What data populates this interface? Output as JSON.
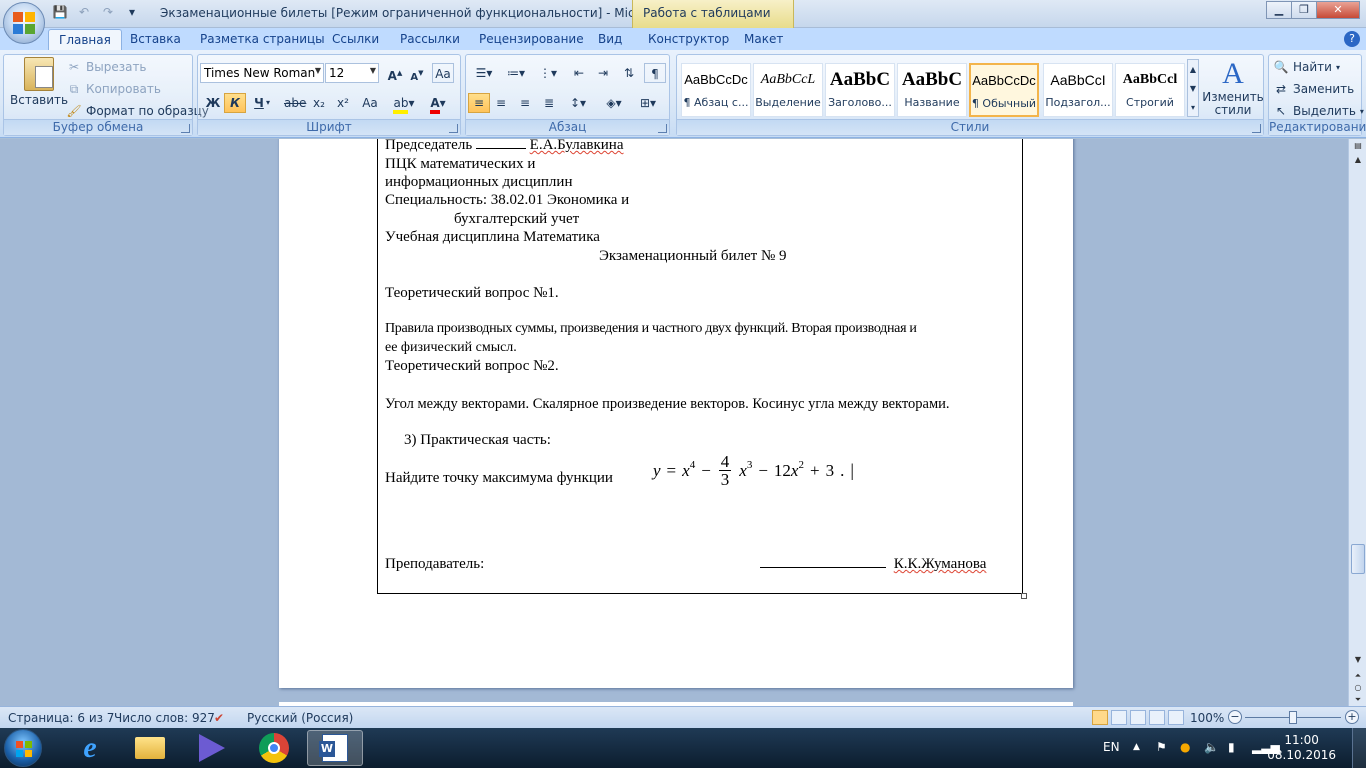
{
  "window": {
    "title": "Экзаменационные билеты  [Режим ограниченной функциональности] - Microso...",
    "context_tab_group": "Работа с таблицами",
    "controls": {
      "minimize": "▁",
      "maximize": "❐",
      "close": "✕"
    }
  },
  "tabs": [
    "Главная",
    "Вставка",
    "Разметка страницы",
    "Ссылки",
    "Рассылки",
    "Рецензирование",
    "Вид",
    "Конструктор",
    "Макет"
  ],
  "ribbon": {
    "clipboard": {
      "paste": "Вставить",
      "cut": "Вырезать",
      "copy": "Копировать",
      "format_painter": "Формат по образцу",
      "label": "Буфер обмена"
    },
    "font": {
      "font_name": "Times New Roman",
      "font_size": "12",
      "bold": "Ж",
      "italic": "К",
      "underline": "Ч",
      "strike": "abe",
      "subscript": "x₂",
      "superscript": "x²",
      "change_case": "Aa",
      "label": "Шрифт"
    },
    "paragraph": {
      "label": "Абзац"
    },
    "styles": {
      "items": [
        {
          "sample": "AaBbCcDc",
          "name": "¶ Абзац с..."
        },
        {
          "sample": "AaBbCcL",
          "name": "Выделение"
        },
        {
          "sample": "AaBbC",
          "name": "Заголово..."
        },
        {
          "sample": "AaBbC",
          "name": "Название"
        },
        {
          "sample": "AaBbCcDc",
          "name": "¶ Обычный"
        },
        {
          "sample": "AaBbCcI",
          "name": "Подзагол..."
        },
        {
          "sample": "AaBbCcl",
          "name": "Строгий"
        }
      ],
      "change_styles": "Изменить стили",
      "label": "Стили"
    },
    "editing": {
      "find": "Найти",
      "replace": "Заменить",
      "select": "Выделить",
      "label": "Редактирование"
    }
  },
  "document": {
    "chair_prefix": "Председатель",
    "chair_name": "Е.А.Булавкина",
    "committee_line1": "ПЦК математических и",
    "committee_line2": "информационных дисциплин",
    "specialty_line1": "Специальность: 38.02.01 Экономика и",
    "specialty_line2": "бухгалтерский учет",
    "discipline": "Учебная дисциплина Математика",
    "ticket_title": "Экзаменационный билет № 9",
    "q1_heading": "Теоретический вопрос №1.",
    "q1_text_line1": "Правила производных суммы, произведения и частного двух функций. Вторая производная и",
    "q1_text_line2": "ее физический  смысл.",
    "q2_heading": "Теоретический вопрос №2.",
    "q2_text": "Угол между векторами. Скалярное произведение векторов. Косинус угла между векторами.",
    "q3_heading": "3) Практическая часть:",
    "task_text": "Найдите  точку  максимума  функции",
    "formula": {
      "y": "y",
      "eq": "=",
      "x": "x",
      "p4": "4",
      "minus1": "−",
      "num": "4",
      "den": "3",
      "p3": "3",
      "minus2": "−",
      "coef": "12",
      "p2": "2",
      "plus": "+",
      "const": "3",
      "end": "."
    },
    "teacher_label": "Преподаватель:",
    "teacher_name": "К.К.Жуманова"
  },
  "statusbar": {
    "page": "Страница: 6 из 7",
    "words": "Число слов: 927",
    "language": "Русский (Россия)",
    "zoom": "100%"
  },
  "taskbar": {
    "lang": "EN",
    "time": "11:00",
    "date": "08.10.2016"
  }
}
